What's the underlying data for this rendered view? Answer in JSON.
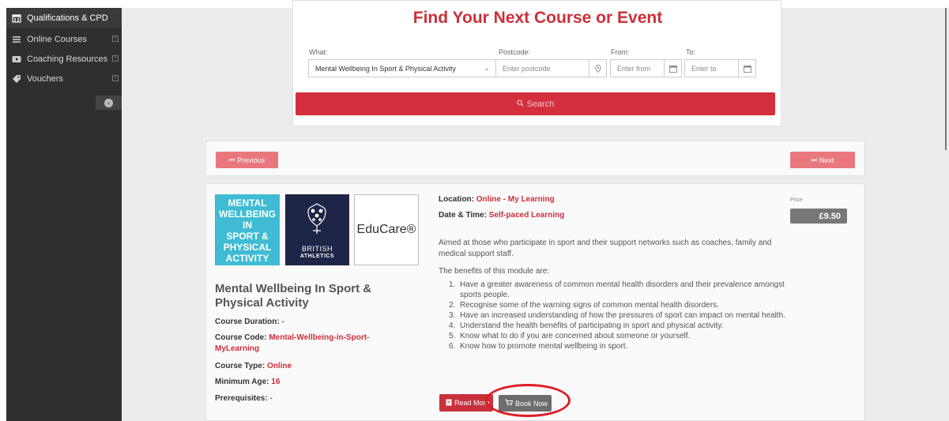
{
  "sidebar": {
    "items": [
      {
        "label": "Qualifications & CPD",
        "icon": "calendar-icon",
        "active": true
      },
      {
        "label": "Online Courses",
        "icon": "list-icon"
      },
      {
        "label": "Coaching Resources",
        "icon": "play-icon"
      },
      {
        "label": "Vouchers",
        "icon": "tag-icon"
      }
    ]
  },
  "search": {
    "title": "Find Your Next Course or Event",
    "what_label": "What:",
    "what_value": "Mental Wellbeing In Sport & Physical Activity",
    "postcode_label": "Postcode:",
    "postcode_placeholder": "Enter postcode",
    "from_label": "From:",
    "from_placeholder": "Enter from",
    "to_label": "To:",
    "to_placeholder": "Enter to",
    "search_label": "Search"
  },
  "nav": {
    "previous_label": "Previous",
    "next_label": "Next"
  },
  "logos": {
    "mental_text": [
      "MENTAL",
      "WELLBEING IN",
      "SPORT &",
      "PHYSICAL",
      "ACTIVITY"
    ],
    "ba_line1": "BRITISH",
    "ba_line2": "ATHLETICS",
    "educare": "EduCare®"
  },
  "course": {
    "title": "Mental Wellbeing In Sport & Physical Activity",
    "duration_label": "Course Duration:",
    "duration_value": "-",
    "code_label": "Course Code:",
    "code_value": "Mental-Wellbeing-in-Sport-MyLearning",
    "type_label": "Course Type:",
    "type_value": "Online",
    "min_age_label": "Minimum Age:",
    "min_age_value": "16",
    "prereq_label": "Prerequisites:",
    "prereq_value": "-",
    "location_label": "Location:",
    "location_value": "Online - My Learning",
    "datetime_label": "Date & Time:",
    "datetime_value": "Self-paced Learning",
    "description": "Aimed at those who participate in sport and their support networks such as coaches, family and medical support staff.",
    "benefits_intro": "The benefits of this module are:",
    "benefits": [
      "Have a greater awareness of common mental health disorders and their prevalence amongst sports people.",
      "Recognise some of the warning signs of common mental health disorders.",
      "Have an increased understanding of how the pressures of sport can impact on mental health.",
      "Understand the health benefits of participating in sport and physical activity.",
      "Know what to do if you are concerned about someone or yourself.",
      "Know how to promote mental wellbeing in sport."
    ],
    "price_label": "Price",
    "price_value": "£9.50",
    "read_more_label": "Read More",
    "book_now_label": "Book Now"
  },
  "colors": {
    "accent": "#d32f3c",
    "sidebar_bg": "#2f2f2f",
    "highlight": "#e01b24"
  }
}
